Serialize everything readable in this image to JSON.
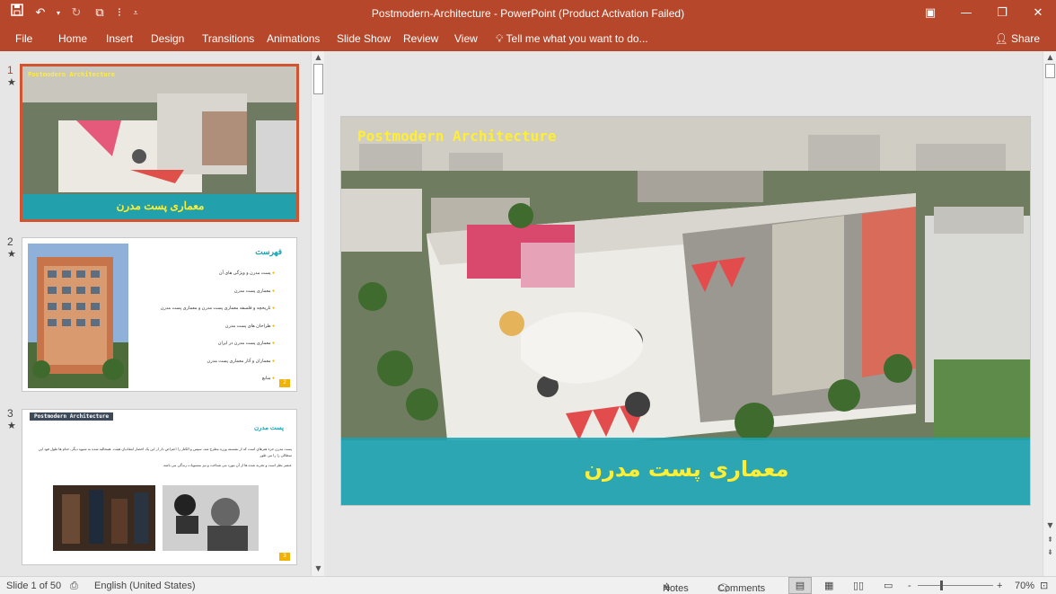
{
  "window": {
    "title": "Postmodern-Architecture - PowerPoint (Product Activation Failed)"
  },
  "ribbon": {
    "tabs": [
      {
        "label": "File"
      },
      {
        "label": "Home"
      },
      {
        "label": "Insert"
      },
      {
        "label": "Design"
      },
      {
        "label": "Transitions"
      },
      {
        "label": "Animations"
      },
      {
        "label": "Slide Show"
      },
      {
        "label": "Review"
      },
      {
        "label": "View"
      }
    ],
    "tell_me": "Tell me what you want to do...",
    "share": "Share"
  },
  "thumbnails": [
    {
      "number": "1",
      "title_en": "Postmodern Architecture",
      "title_fa": "معماری پست مدرن"
    },
    {
      "number": "2",
      "heading": "فهرست",
      "items": [
        "پست مدرن و ویژگی های آن",
        "معماری پست مدرن",
        "تاریخچه و فلسفه معماری پست مدرن و معماری پست مدرن",
        "طراحان های پست مدرن",
        "معماری پست مدرن در ایران",
        "معماران و آثار معماری پست مدرن",
        "منابع"
      ],
      "page": "2"
    },
    {
      "number": "3",
      "tag": "Postmodern Architecture",
      "heading": "پست مدرن",
      "body1": "پست مدرن جزء هنرهای است که از نشسته ورزه مطرح شد، سپس و الکتار را اعتراض دار از این یک احضار انتقادیان هیئت. همحالیه شده به شیوه دیگر، حتام ها طول فود این سطالی را را می طور",
      "body2": "عنصر نظر است و تجربه شده ها از آن مورد می شناخت و نیز منسوبات زندگی می باشد.",
      "page": "3"
    }
  ],
  "slide": {
    "title_en": "Postmodern Architecture",
    "title_fa": "معماری پست مدرن",
    "accent_color": "#1aa4b4",
    "title_color": "#ffee33"
  },
  "status": {
    "slide_info": "Slide 1 of 50",
    "language": "English (United States)",
    "notes": "Notes",
    "comments": "Comments",
    "zoom": "70%",
    "zoom_minus": "-",
    "zoom_plus": "+"
  }
}
